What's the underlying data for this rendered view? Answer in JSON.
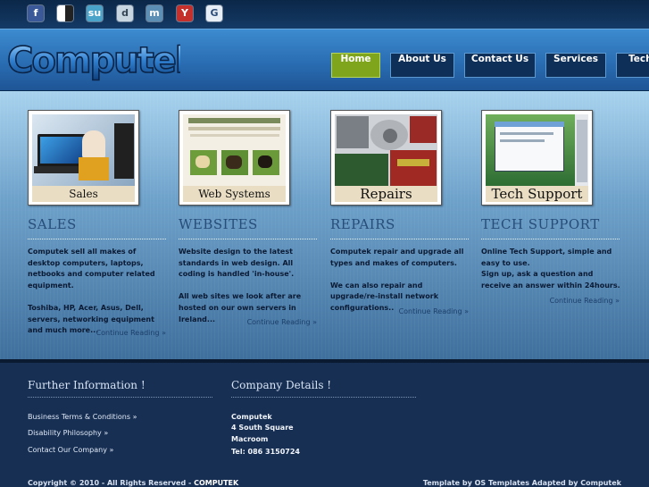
{
  "social_icons": [
    "facebook-icon",
    "delicious-icon",
    "stumbleupon-icon",
    "digg-icon",
    "myspace-icon",
    "youtube-icon",
    "google-icon"
  ],
  "brand": {
    "logo_text": "Computek"
  },
  "nav": [
    {
      "label": "Home",
      "active": true
    },
    {
      "label": "About Us",
      "active": false
    },
    {
      "label": "Contact Us",
      "active": false
    },
    {
      "label": "Services",
      "active": false
    },
    {
      "label": "Tech",
      "active": false
    }
  ],
  "sections": [
    {
      "caption": "Sales",
      "title": "SALES",
      "body": "Computek sell all makes of desktop computers, laptops, netbooks and computer related equipment.\n\nToshiba, HP, Acer, Asus, Dell, servers, networking equipment and much more...",
      "more": "Continue Reading »"
    },
    {
      "caption": "Web Systems",
      "title": "WEBSITES",
      "body": "Website design to the latest standards in web design. All coding is handled 'in-house'.\n\nAll web sites we look after are hosted on our own servers in Ireland...",
      "more": "Continue Reading »"
    },
    {
      "caption": "Repairs",
      "title": "REPAIRS",
      "body": "Computek repair and upgrade all types and makes of computers.\n\nWe can also repair and upgrade/re-install network configurations..",
      "more": "Continue Reading »"
    },
    {
      "caption": "Tech Support",
      "title": "TECH SUPPORT",
      "body": "Online Tech Support, simple and easy to use.\nSign up, ask a question and receive an answer within 24hours.",
      "more": "Continue Reading »"
    }
  ],
  "footer": {
    "further_title": "Further Information !",
    "links": [
      "Business Terms & Conditions »",
      "Disability Philosophy »",
      "Contact Our Company »"
    ],
    "company_title": "Company Details !",
    "company_lines": [
      "Computek",
      "4 South Square",
      "Macroom",
      "Tel: 086 3150724"
    ],
    "copyright": "Copyright © 2010 - All Rights Reserved - ",
    "copyright_brand": "COMPUTEK",
    "credit": "Template by OS Templates Adapted by Computek"
  },
  "colors": {
    "nav_active": "#7fa51c",
    "nav_bg": "#0e2f58",
    "header": "#2a6db2",
    "footer": "#182f54"
  }
}
